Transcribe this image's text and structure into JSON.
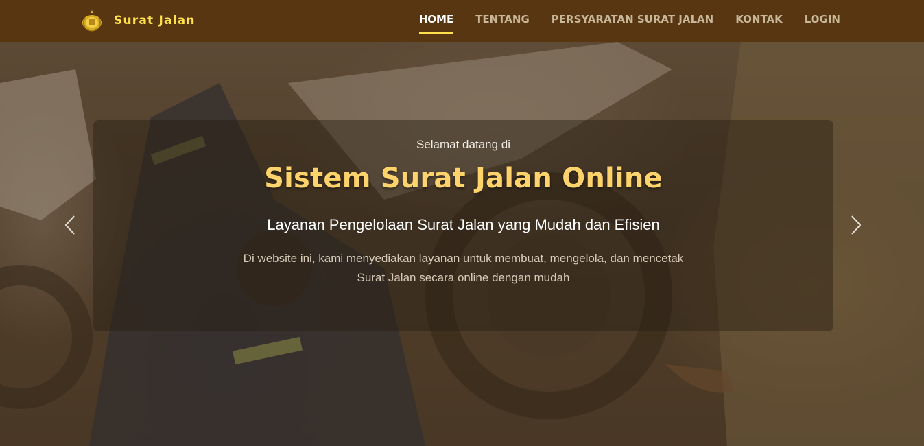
{
  "navbar": {
    "brand": "Surat Jalan",
    "brand_icon": "police-emblem-icon",
    "items": [
      {
        "label": "HOME",
        "active": true
      },
      {
        "label": "TENTANG"
      },
      {
        "label": "PERSYARATAN SURAT JALAN"
      },
      {
        "label": "KONTAK"
      },
      {
        "label": "LOGIN"
      }
    ]
  },
  "hero": {
    "welcome": "Selamat datang di",
    "title": "Sistem Surat Jalan Online",
    "subtitle": "Layanan Pengelolaan Surat Jalan yang Mudah dan Efisien",
    "description": "Di website ini, kami menyediakan layanan untuk membuat, mengelola, dan mencetak Surat Jalan secara online dengan mudah",
    "prev_icon": "chevron-left-icon",
    "next_icon": "chevron-right-icon"
  },
  "colors": {
    "navbar_bg": "#573611",
    "brand": "#ffe14d",
    "title": "#ffd36b",
    "active_underline": "#ffe14d"
  }
}
